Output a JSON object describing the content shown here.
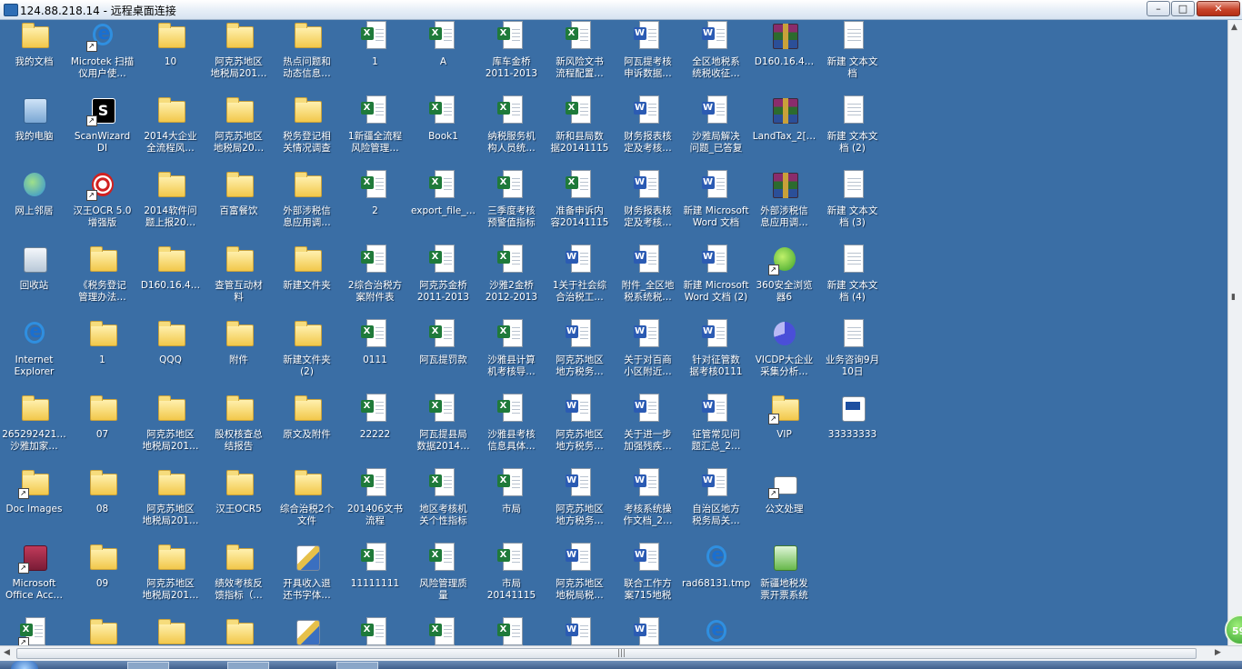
{
  "window": {
    "title": "124.88.218.14 - 远程桌面连接",
    "minimize_label": "–",
    "maximize_label": "□",
    "close_label": "✕"
  },
  "desktop_columns": [
    [
      {
        "label": "我的文档",
        "icon": "my-documents-icon"
      },
      {
        "label": "我的电脑",
        "icon": "computer-icon"
      },
      {
        "label": "网上邻居",
        "icon": "network-icon"
      },
      {
        "label": "回收站",
        "icon": "recycle-bin-icon"
      },
      {
        "label": "Internet\nExplorer",
        "icon": "ie-icon"
      },
      {
        "label": "265292421…\n沙雅加家…",
        "icon": "folder-icon"
      },
      {
        "label": "Doc Images",
        "icon": "folder-icon",
        "shortcut": true
      },
      {
        "label": "Microsoft\nOffice Acc…",
        "icon": "access-icon",
        "shortcut": true
      },
      {
        "label": "",
        "icon": "excel-icon",
        "shortcut": true
      }
    ],
    [
      {
        "label": "Microtek 扫描\n仪用户使…",
        "icon": "ie-icon",
        "shortcut": true
      },
      {
        "label": "ScanWizard DI",
        "icon": "scanwizard-icon",
        "shortcut": true
      },
      {
        "label": "汉王OCR 5.0\n增强版",
        "icon": "ocr-icon",
        "shortcut": true
      },
      {
        "label": "《税务登记\n管理办法…",
        "icon": "folder-icon"
      },
      {
        "label": "1",
        "icon": "folder-icon"
      },
      {
        "label": "07",
        "icon": "folder-icon"
      },
      {
        "label": "08",
        "icon": "folder-icon"
      },
      {
        "label": "09",
        "icon": "folder-icon"
      },
      {
        "label": "",
        "icon": "folder-icon"
      }
    ],
    [
      {
        "label": "10",
        "icon": "folder-icon"
      },
      {
        "label": "2014大企业\n全流程风…",
        "icon": "folder-icon"
      },
      {
        "label": "2014软件问\n题上报20…",
        "icon": "folder-icon"
      },
      {
        "label": "D160.16.4…",
        "icon": "folder-icon"
      },
      {
        "label": "QQQ",
        "icon": "folder-icon"
      },
      {
        "label": "阿克苏地区\n地税局201…",
        "icon": "folder-icon"
      },
      {
        "label": "阿克苏地区\n地税局201…",
        "icon": "folder-icon"
      },
      {
        "label": "阿克苏地区\n地税局201…",
        "icon": "folder-icon"
      },
      {
        "label": "",
        "icon": "folder-icon"
      }
    ],
    [
      {
        "label": "阿克苏地区\n地税局201…",
        "icon": "folder-icon"
      },
      {
        "label": "阿克苏地区\n地税局20…",
        "icon": "folder-icon"
      },
      {
        "label": "百富餐饮",
        "icon": "folder-icon"
      },
      {
        "label": "查管互动材\n料",
        "icon": "folder-icon"
      },
      {
        "label": "附件",
        "icon": "folder-icon"
      },
      {
        "label": "股权核查总\n结报告",
        "icon": "folder-icon"
      },
      {
        "label": "汉王OCR5",
        "icon": "folder-icon"
      },
      {
        "label": "绩效考核反\n馈指标（…",
        "icon": "folder-icon"
      },
      {
        "label": "",
        "icon": "folder-icon"
      }
    ],
    [
      {
        "label": "热点问题和\n动态信息…",
        "icon": "folder-icon"
      },
      {
        "label": "税务登记相\n关情况调查",
        "icon": "folder-icon"
      },
      {
        "label": "外部涉税信\n息应用调…",
        "icon": "folder-icon"
      },
      {
        "label": "新建文件夹",
        "icon": "folder-icon"
      },
      {
        "label": "新建文件夹\n(2)",
        "icon": "folder-icon"
      },
      {
        "label": "原文及附件",
        "icon": "folder-icon"
      },
      {
        "label": "综合治税2个\n文件",
        "icon": "folder-icon"
      },
      {
        "label": "开具收入退\n还书字体…",
        "icon": "pencil-icon"
      },
      {
        "label": "",
        "icon": "pencil-icon"
      }
    ],
    [
      {
        "label": "1",
        "icon": "excel-icon"
      },
      {
        "label": "1新疆全流程\n风险管理…",
        "icon": "excel-icon"
      },
      {
        "label": "2",
        "icon": "excel-icon"
      },
      {
        "label": "2综合治税方\n案附件表",
        "icon": "excel-icon"
      },
      {
        "label": "0111",
        "icon": "excel-icon"
      },
      {
        "label": "22222",
        "icon": "excel-icon"
      },
      {
        "label": "201406文书\n流程",
        "icon": "excel-icon"
      },
      {
        "label": "11111111",
        "icon": "excel-icon"
      },
      {
        "label": "",
        "icon": "excel-icon"
      }
    ],
    [
      {
        "label": "A",
        "icon": "excel-icon"
      },
      {
        "label": "Book1",
        "icon": "excel-icon"
      },
      {
        "label": "export_file_…",
        "icon": "excel-icon"
      },
      {
        "label": "阿克苏金桥\n2011-2013",
        "icon": "excel-icon"
      },
      {
        "label": "阿瓦提罚款",
        "icon": "excel-icon"
      },
      {
        "label": "阿瓦提县局\n数据2014…",
        "icon": "excel-icon"
      },
      {
        "label": "地区考核机\n关个性指标",
        "icon": "excel-icon"
      },
      {
        "label": "风险管理质\n量",
        "icon": "excel-icon"
      },
      {
        "label": "",
        "icon": "excel-icon"
      }
    ],
    [
      {
        "label": "库车金桥\n2011-2013",
        "icon": "excel-icon"
      },
      {
        "label": "纳税服务机\n构人员统…",
        "icon": "excel-icon"
      },
      {
        "label": "三季度考核\n预警值指标",
        "icon": "excel-icon"
      },
      {
        "label": "沙雅2金桥\n2012-2013",
        "icon": "excel-icon"
      },
      {
        "label": "沙雅县计算\n机考核导…",
        "icon": "excel-icon"
      },
      {
        "label": "沙雅县考核\n信息具体…",
        "icon": "excel-icon"
      },
      {
        "label": "市局",
        "icon": "excel-icon"
      },
      {
        "label": "市局\n20141115",
        "icon": "excel-icon"
      },
      {
        "label": "",
        "icon": "excel-icon"
      }
    ],
    [
      {
        "label": "新风险文书\n流程配置…",
        "icon": "excel-icon"
      },
      {
        "label": "新和县局数\n据20141115",
        "icon": "excel-icon"
      },
      {
        "label": "准备申诉内\n容20141115",
        "icon": "excel-icon"
      },
      {
        "label": "1关于社会综\n合治税工…",
        "icon": "word-icon"
      },
      {
        "label": "阿克苏地区\n地方税务…",
        "icon": "word-icon"
      },
      {
        "label": "阿克苏地区\n地方税务…",
        "icon": "word-icon"
      },
      {
        "label": "阿克苏地区\n地方税务…",
        "icon": "word-icon"
      },
      {
        "label": "阿克苏地区\n地税局税…",
        "icon": "word-icon"
      },
      {
        "label": "",
        "icon": "word-icon"
      }
    ],
    [
      {
        "label": "阿瓦提考核\n申诉数据…",
        "icon": "word-icon"
      },
      {
        "label": "财务报表核\n定及考核…",
        "icon": "word-icon"
      },
      {
        "label": "财务报表核\n定及考核…",
        "icon": "word-icon"
      },
      {
        "label": "附件_全区地\n税系统税…",
        "icon": "word-icon"
      },
      {
        "label": "关于对百商\n小区附近…",
        "icon": "word-icon"
      },
      {
        "label": "关于进一步\n加强残疾…",
        "icon": "word-icon"
      },
      {
        "label": "考核系统操\n作文档_2…",
        "icon": "word-icon"
      },
      {
        "label": "联合工作方\n案715地税",
        "icon": "word-icon"
      },
      {
        "label": "",
        "icon": "word-icon"
      }
    ],
    [
      {
        "label": "全区地税系\n统税收征…",
        "icon": "word-icon"
      },
      {
        "label": "沙雅局解决\n问题_已答复",
        "icon": "word-icon"
      },
      {
        "label": "新建 Microsoft\nWord 文档",
        "icon": "word-icon"
      },
      {
        "label": "新建 Microsoft\nWord 文档 (2)",
        "icon": "word-icon"
      },
      {
        "label": "针对征管数\n据考核0111",
        "icon": "word-icon"
      },
      {
        "label": "征管常见问\n题汇总_2…",
        "icon": "word-icon"
      },
      {
        "label": "自治区地方\n税务局关…",
        "icon": "word-icon"
      },
      {
        "label": "rad68131.tmp",
        "icon": "ie-file-icon"
      },
      {
        "label": "",
        "icon": "ie-file-icon"
      }
    ],
    [
      {
        "label": "D160.16.4…",
        "icon": "winrar-icon"
      },
      {
        "label": "LandTax_2[…",
        "icon": "winrar-icon"
      },
      {
        "label": "外部涉税信\n息应用调…",
        "icon": "winrar-icon"
      },
      {
        "label": "360安全浏览\n器6",
        "icon": "browser-360-icon",
        "shortcut": true
      },
      {
        "label": "VICDP大企业\n采集分析…",
        "icon": "pie-chart-icon"
      },
      {
        "label": "VIP",
        "icon": "folder-icon",
        "shortcut": true
      },
      {
        "label": "公文处理",
        "icon": "mail-icon",
        "shortcut": true
      },
      {
        "label": "新疆地税发\n票开票系统",
        "icon": "invoice-icon"
      }
    ],
    [
      {
        "label": "新建 文本文\n档",
        "icon": "text-file-icon"
      },
      {
        "label": "新建 文本文\n档 (2)",
        "icon": "text-file-icon"
      },
      {
        "label": "新建 文本文\n档 (3)",
        "icon": "text-file-icon"
      },
      {
        "label": "新建 文本文\n档 (4)",
        "icon": "text-file-icon"
      },
      {
        "label": "业务咨询9月\n10日",
        "icon": "text-file-icon"
      },
      {
        "label": "33333333",
        "icon": "exe-icon"
      }
    ]
  ],
  "scrollbar": {
    "grip": "|||",
    "left_arrow": "◀",
    "right_arrow": "▶",
    "up_arrow": "▲",
    "down_arrow": "▼"
  },
  "notification_badge": "59"
}
